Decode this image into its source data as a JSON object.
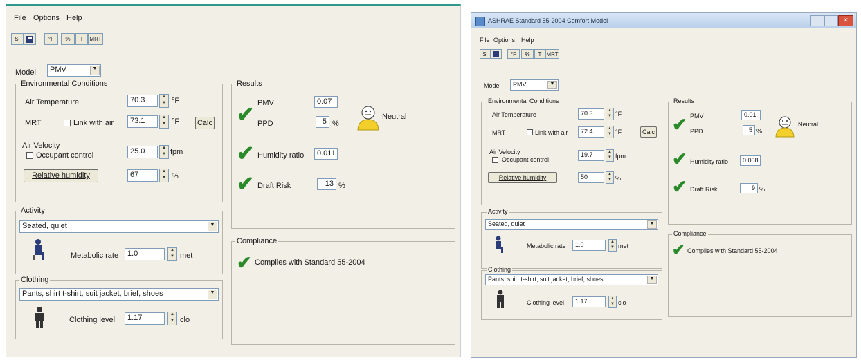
{
  "menu": {
    "file": "File",
    "options": "Options",
    "help": "Help"
  },
  "toolbar": {
    "b1": "SI",
    "b3": "°F",
    "b4": "%",
    "b5": "T",
    "b6": "MRT"
  },
  "model": {
    "label": "Model",
    "value": "PMV"
  },
  "environment": {
    "legend": "Environmental Conditions",
    "air_temp_label": "Air Temperature",
    "air_temp_value": "70.3",
    "air_temp_unit": "°F",
    "mrt_label": "MRT",
    "link_label": "Link with air",
    "mrt_value": "73.1",
    "mrt_unit": "°F",
    "calc_label": "Calc",
    "air_velocity_label": "Air Velocity",
    "occupant_control_label": "Occupant control",
    "air_velocity_value": "25.0",
    "air_velocity_unit": "fpm",
    "rh_button": "Relative humidity",
    "rh_value": "67",
    "rh_unit": "%"
  },
  "results": {
    "legend": "Results",
    "pmv_label": "PMV",
    "pmv_value": "0.07",
    "ppd_label": "PPD",
    "ppd_value": "5",
    "ppd_unit": "%",
    "sensation": "Neutral",
    "humidity_ratio_label": "Humidity ratio",
    "humidity_ratio_value": "0.011",
    "draft_label": "Draft Risk",
    "draft_value": "13",
    "draft_unit": "%"
  },
  "activity": {
    "legend": "Activity",
    "value": "Seated, quiet",
    "met_label": "Metabolic rate",
    "met_value": "1.0",
    "met_unit": "met"
  },
  "compliance": {
    "legend": "Compliance",
    "text": "Complies with Standard 55-2004"
  },
  "clothing": {
    "legend": "Clothing",
    "value": "Pants, shirt t-shirt, suit jacket, brief, shoes",
    "clo_label": "Clothing level",
    "clo_value": "1.17",
    "clo_unit": "clo"
  },
  "right_window": {
    "title": "ASHRAE Standard 55-2004 Comfort Model",
    "mrt_value": "72.4",
    "air_velocity_value": "19.7",
    "rh_value": "50",
    "pmv_value": "0.01",
    "ppd_value": "5",
    "humidity_ratio_value": "0.008",
    "draft_value": "9",
    "clothing_value": "Pants, shirt t-shirt, suit jacket, brief, shoes"
  },
  "colors": {
    "window_bg": "#f1efe6",
    "check": "#2a8a2a",
    "title_close": "#d9533d"
  }
}
